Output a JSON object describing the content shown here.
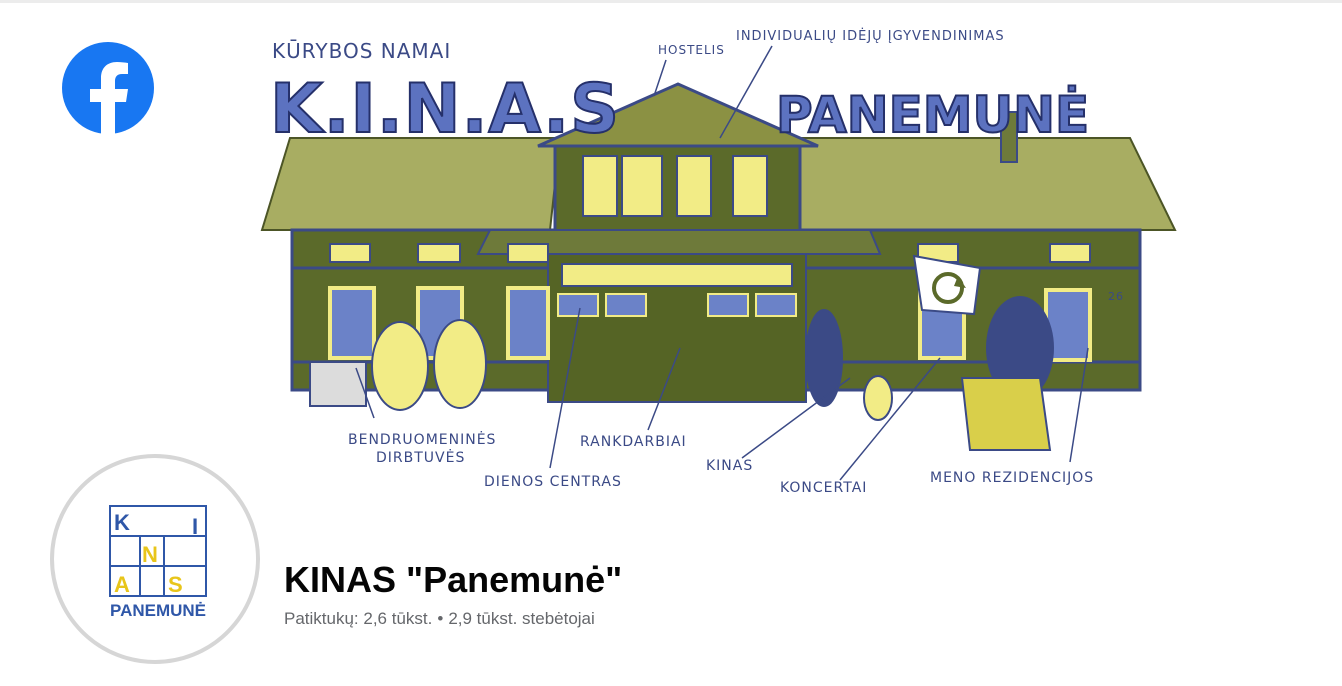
{
  "app": {
    "name": "Facebook",
    "icon": "facebook-logo-icon",
    "brand_color": "#1877f2"
  },
  "cover": {
    "heading_small": "KŪRYBOS NAMAI",
    "heading_left": "K.I.N.A.S",
    "heading_right": "PANEMUNĖ",
    "house_number": "26",
    "recycle_flag_icon": "recycle-icon",
    "labels": {
      "hostelis": "HOSTELIS",
      "ideju": "INDIVIDUALIŲ IDĖJŲ ĮGYVENDINIMAS",
      "bendruomenines_1": "BENDRUOMENINĖS",
      "bendruomenines_2": "DIRBTUVĖS",
      "dienos_centras": "DIENOS CENTRAS",
      "rankdarbiai": "RANKDARBIAI",
      "kinas": "KINAS",
      "koncertai": "KONCERTAI",
      "meno": "MENO REZIDENCIJOS"
    },
    "colors": {
      "ink": "#3b4a86",
      "olive": "#5b6a2a",
      "yellow": "#f2ec86",
      "roof": "#a8ad62"
    }
  },
  "profile": {
    "avatar_letters": [
      "K",
      "I",
      "N",
      "A",
      "S"
    ],
    "avatar_word": "PANEMUNĖ",
    "name": "KINAS \"Panemunė\"",
    "likes": "Patiktukų: 2,6 tūkst.",
    "separator": "•",
    "followers": "2,9 tūkst. stebėtojai"
  }
}
